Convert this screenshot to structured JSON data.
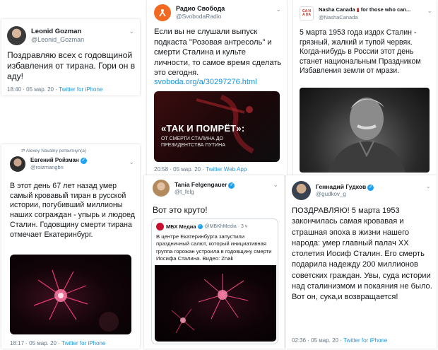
{
  "colors": {
    "link": "#1b95e0",
    "verified": "#1da1f2",
    "muted": "#657786"
  },
  "tweets": [
    {
      "display_name": "Leonid Gozman",
      "handle": "@Leonid_Gozman",
      "text": "Поздравляю всех с годовщиной избавления от тирана. Гори он в аду!",
      "time": "18:40 · 05 мар. 20 ·",
      "via": "Twitter for iPhone"
    },
    {
      "display_name": "Радио Свобода",
      "handle": "@SvobodaRadio",
      "text": "Если вы не слушали выпуск подкаста \"Розовая антресоль\" и смерти Сталина и культе личности, то самое время сделать это сегодня.",
      "link": "svoboda.org/a/30297276.html",
      "media_title": "«ТАК И ПОМРЁТ»:",
      "media_subtitle": "ОТ СМЕРТИ СТАЛИНА ДО ПРЕЗИДЕНТСТВА ПУТИНА",
      "time": "20:58 · 05 мар. 20 ·",
      "via": "Twitter Web App"
    },
    {
      "display_name": "Nasha Canada",
      "display_name_extra": "for those who can...",
      "logo_text": "CA NA DA",
      "handle": "@NashaCanada",
      "text": "5 марта 1953 года издох Сталин - грязный, жалкий и тупой червяк. Когда-нибудь в России этот день станет национальным Праздником Избавления земли от мрази."
    },
    {
      "retweet": "Alexey Navalny ретвитнул(а)",
      "display_name": "Евгений Ройзман",
      "handle": "@roizmangbn",
      "text": "В этот день 67 лет назад умер самый кровавый тиран в русской истории, погубивший миллионы наших сограждан - упырь и людоед Сталин. Годовщину смерти тирана отмечает Екатеринбург.",
      "time": "18:17 · 05 мар. 20 ·",
      "via": "Twitter for iPhone"
    },
    {
      "display_name": "Tania Felgengauer",
      "handle": "@t_felg",
      "text": "Вот это круто!",
      "quote_name": "МБХ Медиа",
      "quote_handle": "@MBKhMedia · 3 ч",
      "quote_text": "В центре Екатеринбурга запустили праздничный салют, который инициативная группа горожан устроила в годовщину смерти Иосифа Сталина. Видео: Znak"
    },
    {
      "display_name": "Геннадий Гудков",
      "handle": "@gudkov_g",
      "text": "ПОЗДРАВЛЯЮ! 5 марта 1953 закончилась самая кровавая и страшная эпоха в жизни нашего народа: умер главный палач ХХ столетия Иосиф Сталин. Его смерть подарила надежду 200 миллионов советских граждан. Увы, суда истории над сталинизмом и покаяния не было. Вот он, сука,и возвращается!",
      "time": "02:36 · 05 мар. 20 ·",
      "via": "Twitter for iPhone"
    }
  ]
}
